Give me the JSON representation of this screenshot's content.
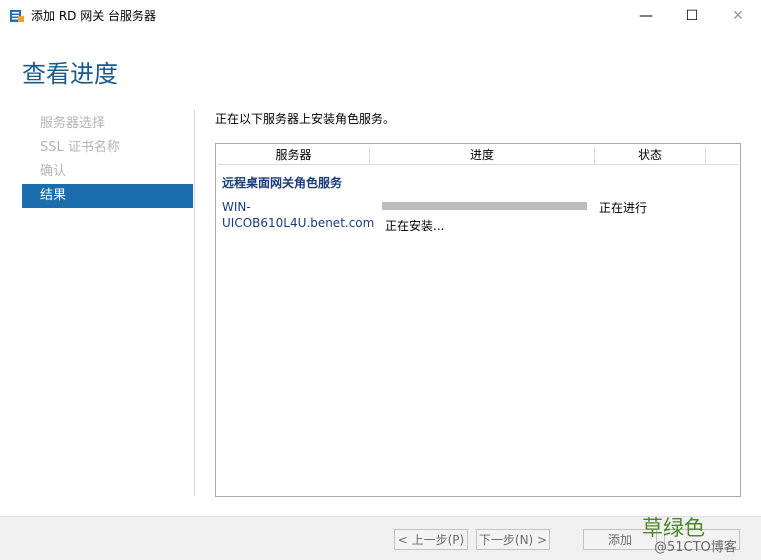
{
  "window": {
    "title": "添加 RD 网关 台服务器",
    "min_glyph": "—",
    "max_glyph": "☐",
    "close_glyph": "✕"
  },
  "header": {
    "page_title": "查看进度"
  },
  "nav": {
    "items": [
      {
        "label": "服务器选择",
        "state": "disabled"
      },
      {
        "label": "SSL 证书名称",
        "state": "disabled"
      },
      {
        "label": "确认",
        "state": "disabled"
      },
      {
        "label": "结果",
        "state": "active"
      }
    ]
  },
  "content": {
    "description": "正在以下服务器上安装角色服务。",
    "columns": [
      "服务器",
      "进度",
      "状态",
      ""
    ],
    "group_label": "远程桌面网关角色服务",
    "rows": [
      {
        "server": "WIN-UICOB610L4U.benet.com",
        "progress_fraction": 1.0,
        "progress_text": "正在安装...",
        "status": "正在进行"
      }
    ]
  },
  "footer": {
    "prev_label": "< 上一步(P)",
    "next_label": "下一步(N) >",
    "add_label": "添加",
    "cancel_label": ""
  },
  "watermark": {
    "main": "草绿色",
    "sub": "@51CTO博客"
  },
  "colors": {
    "accent": "#1a6eae",
    "title_blue": "#1c5a8a",
    "link_blue": "#1a3b7a",
    "footer_bg": "#f0f0f0"
  },
  "icons": {
    "app": "server-manager-icon"
  }
}
